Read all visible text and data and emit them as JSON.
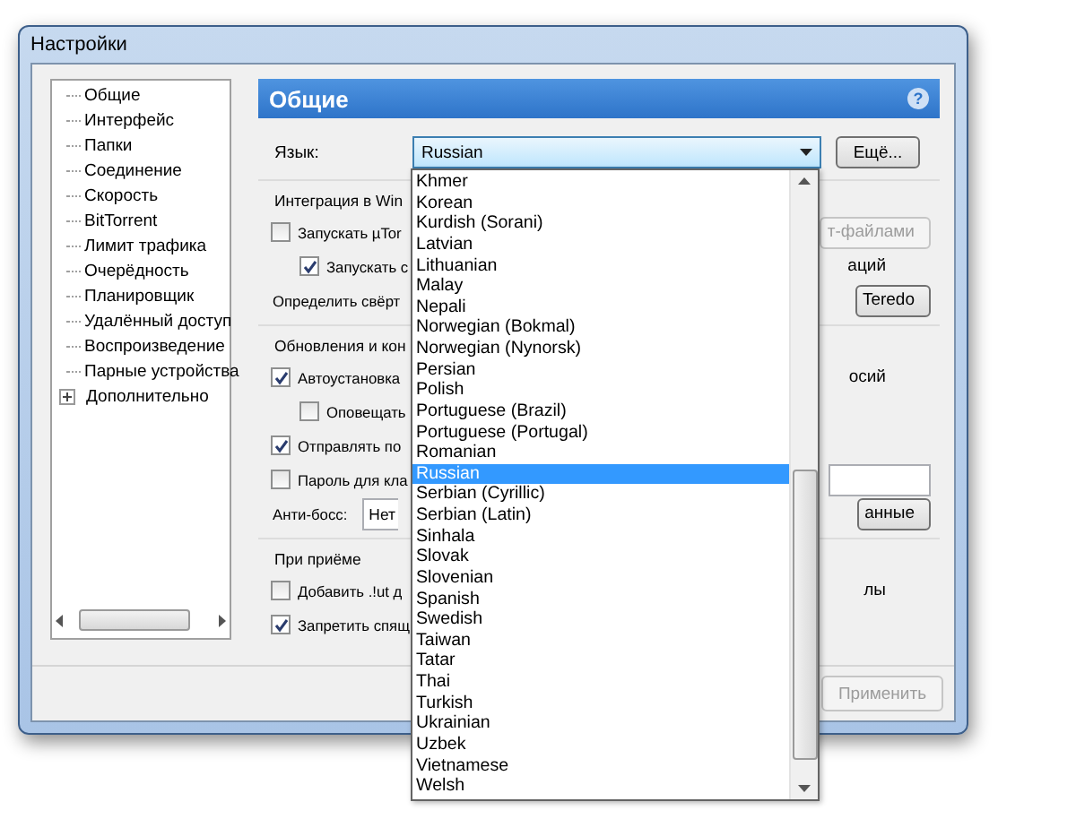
{
  "window": {
    "title": "Настройки"
  },
  "sidebar": {
    "items": [
      {
        "label": "Общие",
        "kind": "leaf"
      },
      {
        "label": "Интерфейс",
        "kind": "leaf"
      },
      {
        "label": "Папки",
        "kind": "leaf"
      },
      {
        "label": "Соединение",
        "kind": "leaf"
      },
      {
        "label": "Скорость",
        "kind": "leaf"
      },
      {
        "label": "BitTorrent",
        "kind": "leaf"
      },
      {
        "label": "Лимит трафика",
        "kind": "leaf"
      },
      {
        "label": "Очерёдность",
        "kind": "leaf"
      },
      {
        "label": "Планировщик",
        "kind": "leaf"
      },
      {
        "label": "Удалённый доступ",
        "kind": "leaf"
      },
      {
        "label": "Воспроизведение",
        "kind": "leaf"
      },
      {
        "label": "Парные устройства",
        "kind": "leaf"
      },
      {
        "label": "Дополнительно",
        "kind": "group",
        "expanded": false
      }
    ]
  },
  "panel": {
    "title": "Общие",
    "help": "?"
  },
  "language": {
    "label": "Язык:",
    "value": "Russian",
    "more_button": "Ещё..."
  },
  "groups": [
    {
      "heading": "Интеграция в Win",
      "rows": [
        {
          "kind": "checkbox",
          "label": "Запускать µTor",
          "checked": false,
          "right": {
            "kind": "button",
            "text": "т-файлами",
            "disabled": true
          },
          "children": [
            {
              "kind": "checkbox",
              "label": "Запускать с",
              "checked": true,
              "right": {
                "kind": "text",
                "text": "аций"
              }
            }
          ]
        },
        {
          "kind": "text",
          "label": "Определить свёрт",
          "right": {
            "kind": "button",
            "text": "Teredo",
            "disabled": false
          }
        }
      ]
    },
    {
      "heading": "Обновления и кон",
      "rows": [
        {
          "kind": "checkbox",
          "label": "Автоустановка",
          "checked": true,
          "right": {
            "kind": "text",
            "text": "осий"
          },
          "children": [
            {
              "kind": "checkbox",
              "label": "Оповещать",
              "checked": false
            }
          ]
        },
        {
          "kind": "checkbox",
          "label": "Отправлять по",
          "checked": true
        },
        {
          "kind": "checkbox",
          "label": "Пароль для кла",
          "checked": false,
          "right": {
            "kind": "field"
          }
        },
        {
          "kind": "select",
          "label": "Анти-босс:",
          "value": "Нет",
          "right": {
            "kind": "button",
            "text": "анные",
            "disabled": false
          }
        }
      ]
    },
    {
      "heading": "При приёме",
      "rows": [
        {
          "kind": "checkbox",
          "label": "Добавить .!ut д",
          "checked": false,
          "right": {
            "kind": "text",
            "text": "лы"
          }
        },
        {
          "kind": "checkbox",
          "label": "Запретить спящ",
          "checked": true
        }
      ]
    }
  ],
  "footer": {
    "buttons": [
      {
        "label": "Применить",
        "disabled": true
      }
    ]
  },
  "dropdown": {
    "items": [
      {
        "label": "Khmer",
        "selected": false
      },
      {
        "label": "Korean",
        "selected": false
      },
      {
        "label": "Kurdish (Sorani)",
        "selected": false
      },
      {
        "label": "Latvian",
        "selected": false
      },
      {
        "label": "Lithuanian",
        "selected": false
      },
      {
        "label": "Malay",
        "selected": false
      },
      {
        "label": "Nepali",
        "selected": false
      },
      {
        "label": "Norwegian (Bokmal)",
        "selected": false
      },
      {
        "label": "Norwegian (Nynorsk)",
        "selected": false
      },
      {
        "label": "Persian",
        "selected": false
      },
      {
        "label": "Polish",
        "selected": false
      },
      {
        "label": "Portuguese (Brazil)",
        "selected": false
      },
      {
        "label": "Portuguese (Portugal)",
        "selected": false
      },
      {
        "label": "Romanian",
        "selected": false
      },
      {
        "label": "Russian",
        "selected": true
      },
      {
        "label": "Serbian (Cyrillic)",
        "selected": false
      },
      {
        "label": "Serbian (Latin)",
        "selected": false
      },
      {
        "label": "Sinhala",
        "selected": false
      },
      {
        "label": "Slovak",
        "selected": false
      },
      {
        "label": "Slovenian",
        "selected": false
      },
      {
        "label": "Spanish",
        "selected": false
      },
      {
        "label": "Swedish",
        "selected": false
      },
      {
        "label": "Taiwan",
        "selected": false
      },
      {
        "label": "Tatar",
        "selected": false
      },
      {
        "label": "Thai",
        "selected": false
      },
      {
        "label": "Turkish",
        "selected": false
      },
      {
        "label": "Ukrainian",
        "selected": false
      },
      {
        "label": "Uzbek",
        "selected": false
      },
      {
        "label": "Vietnamese",
        "selected": false
      },
      {
        "label": "Welsh",
        "selected": false
      }
    ]
  }
}
